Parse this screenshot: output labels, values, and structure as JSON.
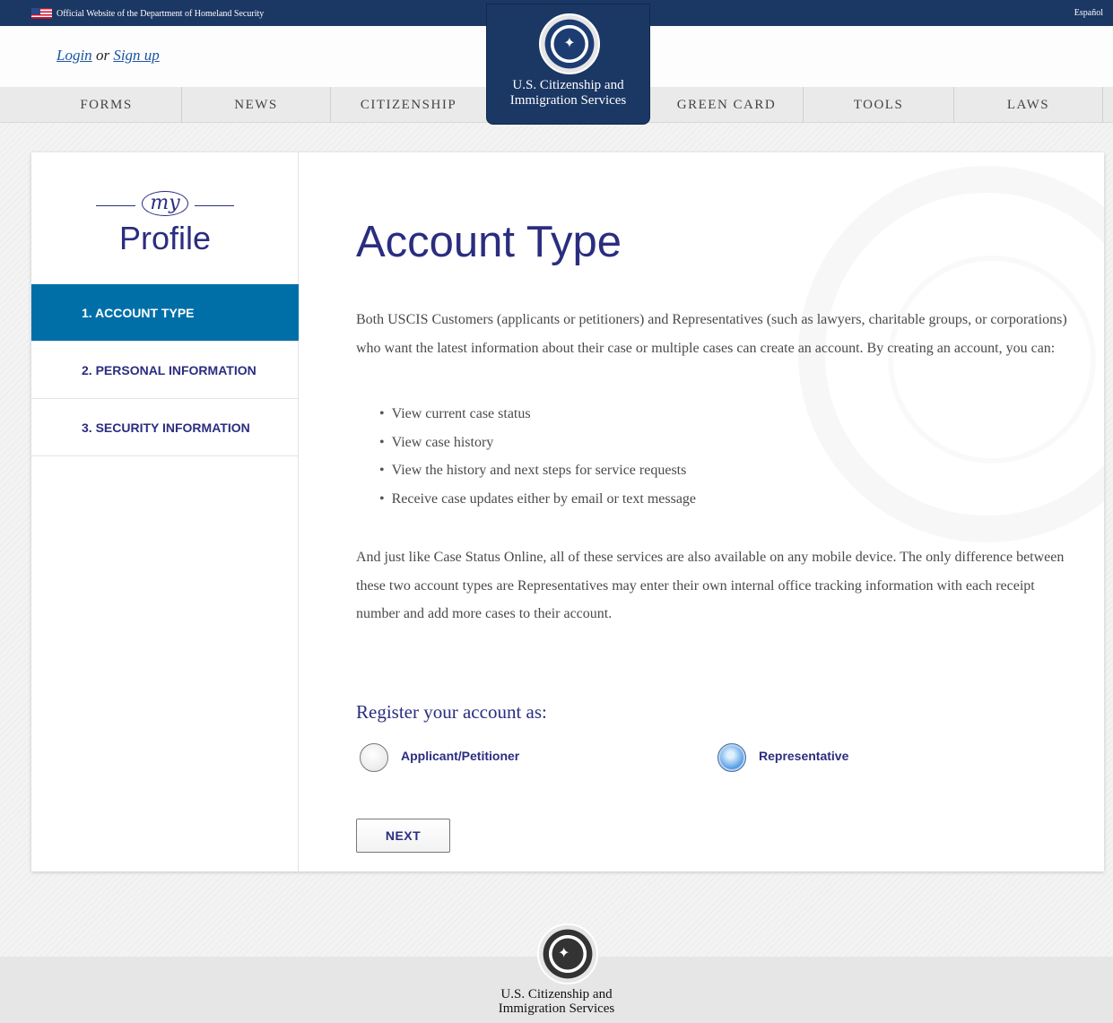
{
  "topbar": {
    "official": "Official Website of the Department of Homeland Security",
    "language": "Español",
    "flag_icon": "us-flag-icon"
  },
  "auth": {
    "login": "Login",
    "or": "or",
    "signup": "Sign up"
  },
  "nav": {
    "items": [
      "FORMS",
      "NEWS",
      "CITIZENSHIP",
      "GREEN CARD",
      "TOOLS",
      "LAWS"
    ]
  },
  "logo": {
    "icon": "dhs-seal-icon",
    "line1": "U.S. Citizenship and",
    "line2": "Immigration Services"
  },
  "sidebar": {
    "my": "my",
    "profile": "Profile",
    "steps": [
      {
        "label": "1. ACCOUNT TYPE",
        "active": true
      },
      {
        "label": "2. PERSONAL INFORMATION",
        "active": false
      },
      {
        "label": "3. SECURITY INFORMATION",
        "active": false
      }
    ]
  },
  "main": {
    "title": "Account Type",
    "intro": "Both USCIS Customers (applicants or petitioners) and Representatives (such as lawyers, charitable groups, or corporations) who want the latest information about their case or multiple cases can create an account. By creating an account, you can:",
    "bullets": [
      "View current case status",
      "View case history",
      "View the history and next steps for service requests",
      "Receive case updates either by email or text message"
    ],
    "outro": "And just like Case Status Online, all of these services are also available on any mobile device. The only difference between these two account types are Representatives may enter their own internal office tracking information with each receipt number and add more cases to their account.",
    "register_label": "Register your account as:",
    "options": [
      {
        "label": "Applicant/Petitioner",
        "selected": false
      },
      {
        "label": "Representative",
        "selected": true
      }
    ],
    "next_button": "NEXT"
  },
  "footer": {
    "icon": "dhs-seal-icon",
    "line1": "U.S. Citizenship and",
    "line2": "Immigration Services"
  },
  "colors": {
    "navy": "#1b3764",
    "accent_blue": "#006fa8",
    "heading_purple": "#2b2d80"
  }
}
